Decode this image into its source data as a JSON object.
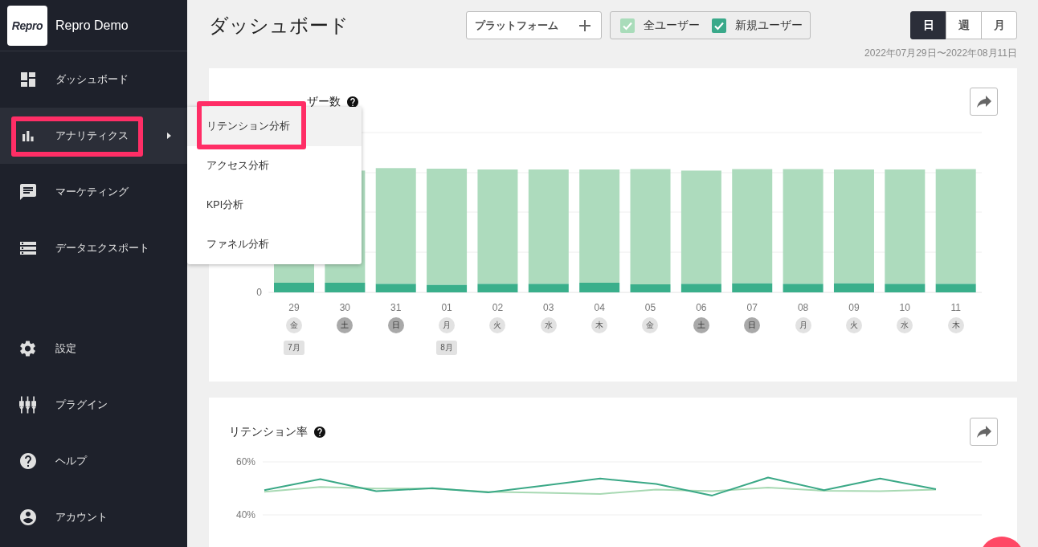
{
  "sidebar": {
    "logo_text": "Repro",
    "app_name": "Repro Demo",
    "items": [
      {
        "label": "ダッシュボード",
        "selected": false,
        "highlighted": false
      },
      {
        "label": "アナリティクス",
        "selected": true,
        "highlighted": true,
        "expanded": true,
        "submenu": [
          {
            "label": "リテンション分析",
            "selected": true,
            "highlighted": true
          },
          {
            "label": "アクセス分析",
            "selected": false,
            "highlighted": false
          },
          {
            "label": "KPI分析",
            "selected": false,
            "highlighted": false
          },
          {
            "label": "ファネル分析",
            "selected": false,
            "highlighted": false
          }
        ]
      },
      {
        "label": "マーケティング",
        "selected": false,
        "highlighted": false
      },
      {
        "label": "データエクスポート",
        "selected": false,
        "highlighted": false
      }
    ],
    "bottom_items": [
      {
        "label": "設定",
        "selected": false,
        "highlighted": false
      },
      {
        "label": "プラグイン",
        "selected": false,
        "highlighted": false
      },
      {
        "label": "ヘルプ",
        "selected": false,
        "highlighted": false
      },
      {
        "label": "アカウント",
        "selected": false,
        "highlighted": false
      }
    ]
  },
  "header": {
    "title": "ダッシュボード",
    "platform_button": {
      "label": "プラットフォーム"
    },
    "segments": [
      {
        "label": "全ユーザー",
        "checked": true,
        "color": "#a9dcba"
      },
      {
        "label": "新規ユーザー",
        "checked": true,
        "color": "#3aa98a"
      }
    ],
    "periods": [
      {
        "label": "日",
        "selected": true
      },
      {
        "label": "週",
        "selected": false
      },
      {
        "label": "月",
        "selected": false
      }
    ],
    "date_range": "2022年07月29日〜2022年08月11日"
  },
  "active_users_card": {
    "title": "ザー数",
    "y_tick": "0",
    "days": [
      {
        "date": "29",
        "weekday": "金",
        "weekend": false,
        "month": "7月"
      },
      {
        "date": "30",
        "weekday": "土",
        "weekend": true
      },
      {
        "date": "31",
        "weekday": "日",
        "weekend": true
      },
      {
        "date": "01",
        "weekday": "月",
        "weekend": false,
        "month": "8月"
      },
      {
        "date": "02",
        "weekday": "火",
        "weekend": false
      },
      {
        "date": "03",
        "weekday": "水",
        "weekend": false
      },
      {
        "date": "04",
        "weekday": "木",
        "weekend": false
      },
      {
        "date": "05",
        "weekday": "金",
        "weekend": false
      },
      {
        "date": "06",
        "weekday": "土",
        "weekend": true
      },
      {
        "date": "07",
        "weekday": "日",
        "weekend": true
      },
      {
        "date": "08",
        "weekday": "月",
        "weekend": false
      },
      {
        "date": "09",
        "weekday": "火",
        "weekend": false
      },
      {
        "date": "10",
        "weekday": "水",
        "weekend": false
      },
      {
        "date": "11",
        "weekday": "木",
        "weekend": false
      }
    ]
  },
  "retention_card": {
    "title": "リテンション率",
    "chart_data": {
      "type": "line",
      "ylim": [
        40,
        60
      ],
      "yticks": [
        {
          "value": 60,
          "label": "60%"
        },
        {
          "value": 40,
          "label": "40%"
        }
      ],
      "series": [
        {
          "color": "#a8d9b3",
          "values": [
            48.7,
            50.5,
            49.9,
            49.9,
            48.7,
            48.3,
            47.9,
            49.5,
            48.9,
            50.3,
            49.1,
            48.9,
            49.5
          ]
        },
        {
          "color": "#3aa886",
          "values": [
            49.3,
            53.5,
            48.9,
            50.1,
            48.5,
            51.1,
            53.7,
            51.7,
            47.3,
            54.1,
            49.3,
            53.7,
            49.7
          ]
        }
      ]
    }
  }
}
